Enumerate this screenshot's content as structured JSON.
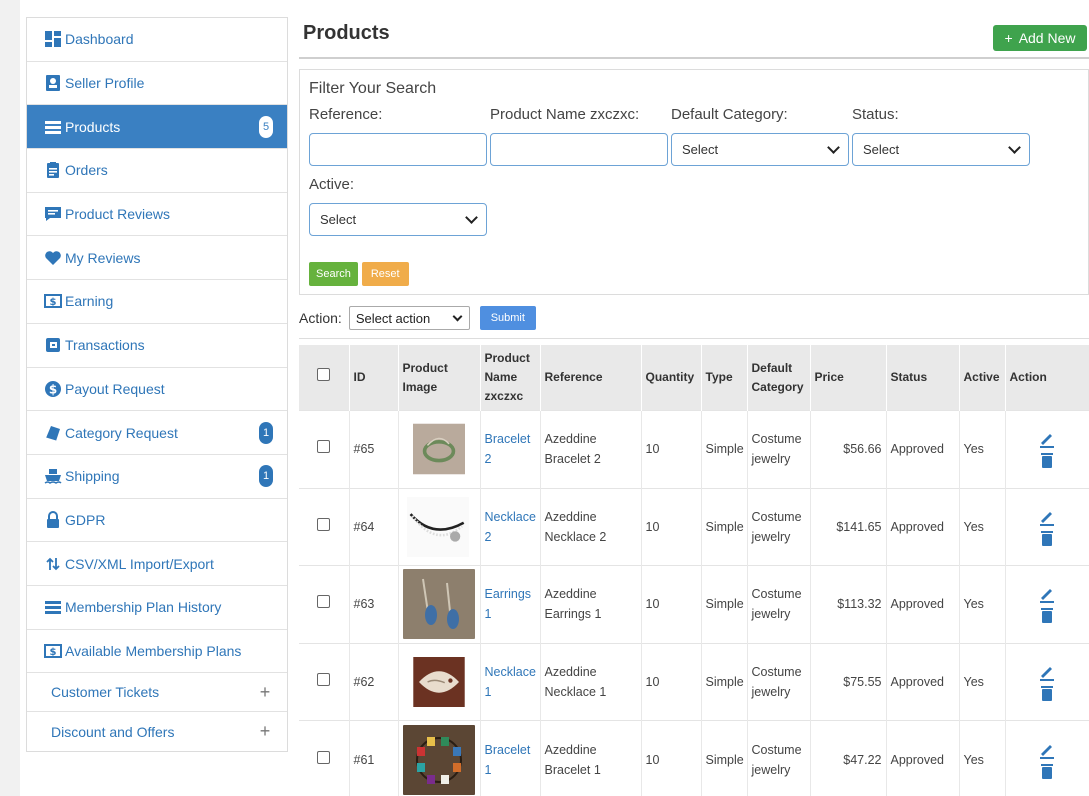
{
  "sidebar": {
    "items": [
      {
        "label": "Dashboard",
        "icon": "dashboard-icon",
        "badge": ""
      },
      {
        "label": "Seller Profile",
        "icon": "profile-card-icon",
        "badge": ""
      },
      {
        "label": "Products",
        "icon": "list-icon",
        "badge": "5",
        "active": true
      },
      {
        "label": "Orders",
        "icon": "clipboard-icon",
        "badge": ""
      },
      {
        "label": "Product Reviews",
        "icon": "comment-icon",
        "badge": ""
      },
      {
        "label": "My Reviews",
        "icon": "heart-icon",
        "badge": ""
      },
      {
        "label": "Earning",
        "icon": "money-icon",
        "badge": ""
      },
      {
        "label": "Transactions",
        "icon": "transactions-icon",
        "badge": ""
      },
      {
        "label": "Payout Request",
        "icon": "dollar-circle-icon",
        "badge": ""
      },
      {
        "label": "Category Request",
        "icon": "book-icon",
        "badge": "1"
      },
      {
        "label": "Shipping",
        "icon": "ship-icon",
        "badge": "1"
      },
      {
        "label": "GDPR",
        "icon": "lock-icon",
        "badge": ""
      },
      {
        "label": "CSV/XML Import/Export",
        "icon": "sort-arrows-icon",
        "badge": ""
      },
      {
        "label": "Membership Plan History",
        "icon": "list-icon",
        "badge": ""
      },
      {
        "label": "Available Membership Plans",
        "icon": "money-icon",
        "badge": ""
      }
    ],
    "expandable": [
      {
        "label": "Customer Tickets"
      },
      {
        "label": "Discount and Offers"
      }
    ]
  },
  "header": {
    "title": "Products",
    "add_label": "Add New"
  },
  "filter": {
    "title": "Filter Your Search",
    "reference_label": "Reference:",
    "product_name_label": "Product Name zxczxc:",
    "default_category_label": "Default Category:",
    "status_label": "Status:",
    "active_label": "Active:",
    "select_placeholder": "Select",
    "search_label": "Search",
    "reset_label": "Reset"
  },
  "bulk_action": {
    "label": "Action:",
    "select_value": "Select action",
    "submit_label": "Submit"
  },
  "table": {
    "headers": {
      "id": "ID",
      "image": "Product Image",
      "name": "Product Name zxczxc",
      "reference": "Reference",
      "quantity": "Quantity",
      "type": "Type",
      "category": "Default Category",
      "price": "Price",
      "status": "Status",
      "active": "Active",
      "action": "Action"
    },
    "rows": [
      {
        "id": "#65",
        "name": "Bracelet 2",
        "reference": "Azeddine Bracelet 2",
        "quantity": "10",
        "type": "Simple",
        "category": "Costume jewelry",
        "price": "$56.66",
        "status": "Approved",
        "active": "Yes"
      },
      {
        "id": "#64",
        "name": "Necklace 2",
        "reference": "Azeddine Necklace 2",
        "quantity": "10",
        "type": "Simple",
        "category": "Costume jewelry",
        "price": "$141.65",
        "status": "Approved",
        "active": "Yes"
      },
      {
        "id": "#63",
        "name": "Earrings 1",
        "reference": "Azeddine Earrings 1",
        "quantity": "10",
        "type": "Simple",
        "category": "Costume jewelry",
        "price": "$113.32",
        "status": "Approved",
        "active": "Yes"
      },
      {
        "id": "#62",
        "name": "Necklace 1",
        "reference": "Azeddine Necklace 1",
        "quantity": "10",
        "type": "Simple",
        "category": "Costume jewelry",
        "price": "$75.55",
        "status": "Approved",
        "active": "Yes"
      },
      {
        "id": "#61",
        "name": "Bracelet 1",
        "reference": "Azeddine Bracelet 1",
        "quantity": "10",
        "type": "Simple",
        "category": "Costume jewelry",
        "price": "$47.22",
        "status": "Approved",
        "active": "Yes"
      }
    ]
  },
  "colors": {
    "accent": "#3a80c2",
    "link": "#2f76b8",
    "add_button": "#3fa34d",
    "search_button": "#66b23d",
    "reset_button": "#f0ac4a",
    "submit_button": "#4f8fe0"
  }
}
